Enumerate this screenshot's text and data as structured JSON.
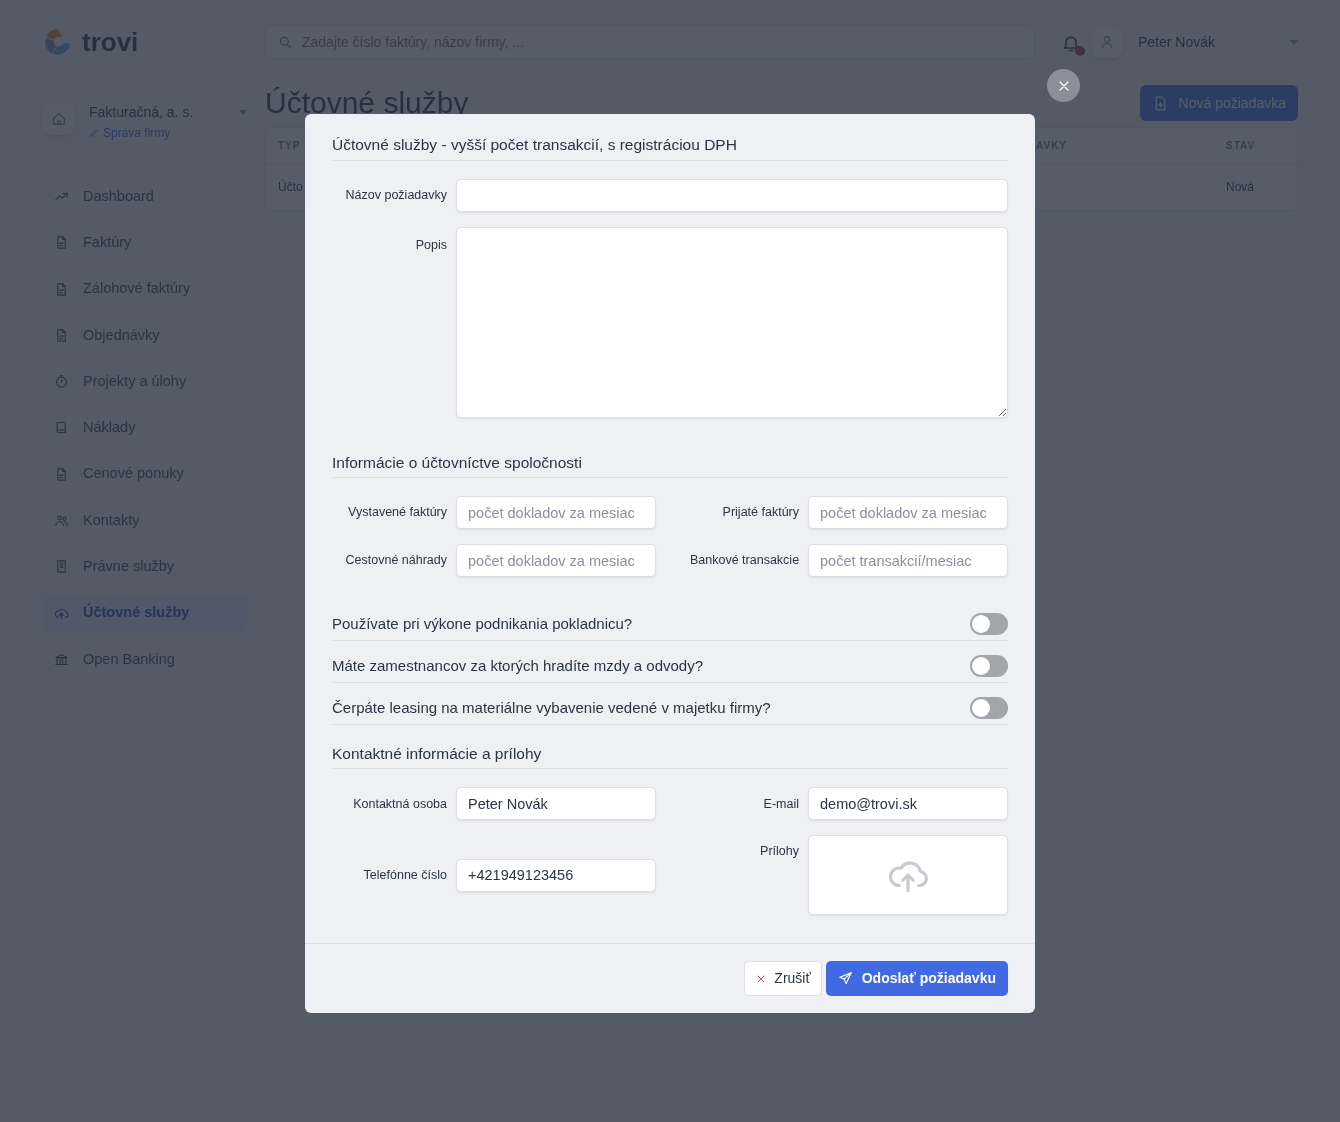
{
  "app": {
    "logo": "trovi",
    "search": {
      "placeholder": "Zadajte číslo faktúry, názov firmy, ..."
    },
    "notification_alert": true,
    "user": {
      "name": "Peter Novák"
    }
  },
  "company": {
    "name": "Fakturačná, a. s.",
    "link": "Správa firmy"
  },
  "sidebar": {
    "items": [
      {
        "label": "Dashboard",
        "selected": false
      },
      {
        "label": "Faktúry",
        "selected": false
      },
      {
        "label": "Zálohové faktúry",
        "selected": false
      },
      {
        "label": "Objednávky",
        "selected": false
      },
      {
        "label": "Projekty a úlohy",
        "selected": false
      },
      {
        "label": "Náklady",
        "selected": false
      },
      {
        "label": "Cenové ponuky",
        "selected": false
      },
      {
        "label": "Kontakty",
        "selected": false
      },
      {
        "label": "Právne služby",
        "selected": false
      },
      {
        "label": "Účtovné služby",
        "selected": true
      },
      {
        "label": "Open Banking",
        "selected": false
      }
    ]
  },
  "page": {
    "title": "Účtovné služby",
    "new_button": "Nová požiadavka",
    "table": {
      "columns": [
        "TYP",
        "AVKY",
        "STAV"
      ],
      "rows": [
        {
          "column_1": "Účto",
          "column_3": "Nová"
        }
      ]
    }
  },
  "modal": {
    "title": "Účtovné služby - vyšší počet transakcií, s registráciou DPH",
    "fields": [
      {
        "label": "Názov požiadavky",
        "kind": "text"
      },
      {
        "label": "Popis",
        "kind": "textarea"
      }
    ],
    "accounting": {
      "heading": "Informácie o účtovníctve spoločnosti",
      "fields": [
        {
          "label": "Vystavené faktúry",
          "placeholder": "počet dokladov za mesiac"
        },
        {
          "label": "Prijaté faktúry",
          "placeholder": "počet dokladov za mesiac"
        },
        {
          "label": "Cestovné náhrady",
          "placeholder": "počet dokladov za mesiac"
        },
        {
          "label": "Bankové transakcie",
          "placeholder": "počet transakcií/mesiac"
        }
      ]
    },
    "questions": [
      {
        "label": "Používate pri výkone podnikania pokladnicu?",
        "on": false
      },
      {
        "label": "Máte zamestnancov za ktorých hradíte mzdy a odvody?",
        "on": false
      },
      {
        "label": "Čerpáte leasing na materiálne vybavenie vedené v majetku firmy?",
        "on": false
      }
    ],
    "contact": {
      "heading": "Kontaktné informácie a prílohy",
      "fields": [
        {
          "label": "Kontaktná osoba",
          "kind": "text",
          "value": "Peter Novák"
        },
        {
          "label": "E-mail",
          "kind": "text",
          "value": "demo@trovi.sk"
        },
        {
          "label": "Telefónne číslo",
          "kind": "text",
          "value": "+421949123456"
        },
        {
          "label": "Prílohy",
          "kind": "upload"
        }
      ]
    },
    "cancel_button": "Zrušiť",
    "submit_button": "Odoslať požiadavku"
  }
}
